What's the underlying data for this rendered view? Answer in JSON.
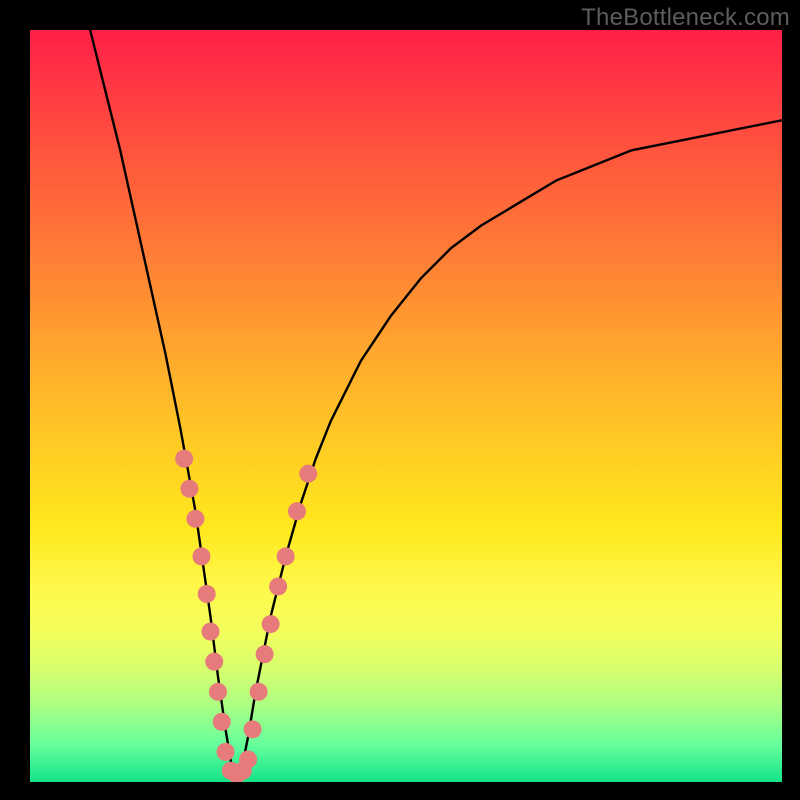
{
  "watermark": "TheBottleneck.com",
  "chart_data": {
    "type": "line",
    "title": "",
    "xlabel": "",
    "ylabel": "",
    "xlim": [
      0,
      100
    ],
    "ylim": [
      0,
      100
    ],
    "axes_visible": false,
    "background": "rainbow-vertical-gradient",
    "curve": {
      "description": "V-shaped bottleneck curve with minimum near x≈27",
      "x": [
        8,
        10,
        12,
        14,
        16,
        18,
        20,
        22,
        24,
        25,
        26,
        27,
        28,
        29,
        30,
        32,
        34,
        36,
        38,
        40,
        44,
        48,
        52,
        56,
        60,
        65,
        70,
        75,
        80,
        85,
        90,
        95,
        100
      ],
      "y": [
        100,
        92,
        84,
        75,
        66,
        57,
        47,
        36,
        22,
        14,
        7,
        1,
        1,
        6,
        12,
        22,
        30,
        37,
        43,
        48,
        56,
        62,
        67,
        71,
        74,
        77,
        80,
        82,
        84,
        85,
        86,
        87,
        88
      ]
    },
    "marker_clusters": [
      {
        "description": "left descending branch markers",
        "points": [
          {
            "x": 20.5,
            "y": 43
          },
          {
            "x": 21.2,
            "y": 39
          },
          {
            "x": 22.0,
            "y": 35
          },
          {
            "x": 22.8,
            "y": 30
          },
          {
            "x": 23.5,
            "y": 25
          },
          {
            "x": 24.0,
            "y": 20
          },
          {
            "x": 24.5,
            "y": 16
          },
          {
            "x": 25.0,
            "y": 12
          },
          {
            "x": 25.5,
            "y": 8
          }
        ]
      },
      {
        "description": "valley floor markers",
        "points": [
          {
            "x": 26.0,
            "y": 4
          },
          {
            "x": 26.7,
            "y": 1.5
          },
          {
            "x": 27.5,
            "y": 1
          },
          {
            "x": 28.3,
            "y": 1.5
          },
          {
            "x": 29.0,
            "y": 3
          }
        ]
      },
      {
        "description": "right ascending branch markers",
        "points": [
          {
            "x": 29.6,
            "y": 7
          },
          {
            "x": 30.4,
            "y": 12
          },
          {
            "x": 31.2,
            "y": 17
          },
          {
            "x": 32.0,
            "y": 21
          },
          {
            "x": 33.0,
            "y": 26
          },
          {
            "x": 34.0,
            "y": 30
          },
          {
            "x": 35.5,
            "y": 36
          },
          {
            "x": 37.0,
            "y": 41
          }
        ]
      }
    ],
    "marker_style": {
      "color": "#e77b7b",
      "radius_px": 9
    }
  }
}
